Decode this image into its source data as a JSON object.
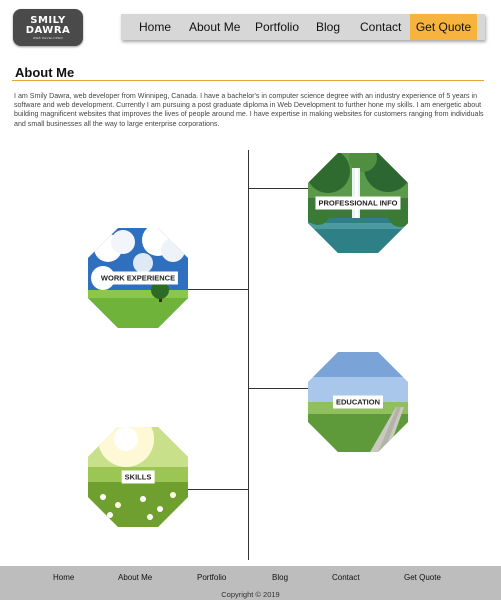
{
  "logo": {
    "line1": "SMILY",
    "line2": "DAWRA",
    "line3": "WEB DEVELOPER"
  },
  "nav": {
    "items": [
      "Home",
      "About Me",
      "Portfolio",
      "Blog",
      "Contact"
    ],
    "cta": "Get Quote",
    "colors": {
      "bar": "#d7d7d7",
      "cta": "#f6b33d"
    }
  },
  "about": {
    "title": "About Me",
    "text": "I am Smily Dawra, web developer from Winnipeg, Canada. I have a bachelor's in computer science degree with an industry experience of 5 years in software and web development. Currently I am pursuing a post graduate diploma in Web Development to further hone my skills. I am energetic about building magnificent websites that improves the lives of people around me. I have expertise in making websites for customers ranging from individuals and small businesses all the way to large enterprise corporations."
  },
  "timeline": {
    "professional_info": "PROFESSIONAL INFO",
    "work_experience": "WORK EXPERIENCE",
    "education": "EDUCATION",
    "skills": "SKILLS"
  },
  "footer": {
    "items": [
      "Home",
      "About Me",
      "Portfolio",
      "Blog",
      "Contact",
      "Get Quote"
    ],
    "copyright": "Copyright © 2019"
  }
}
